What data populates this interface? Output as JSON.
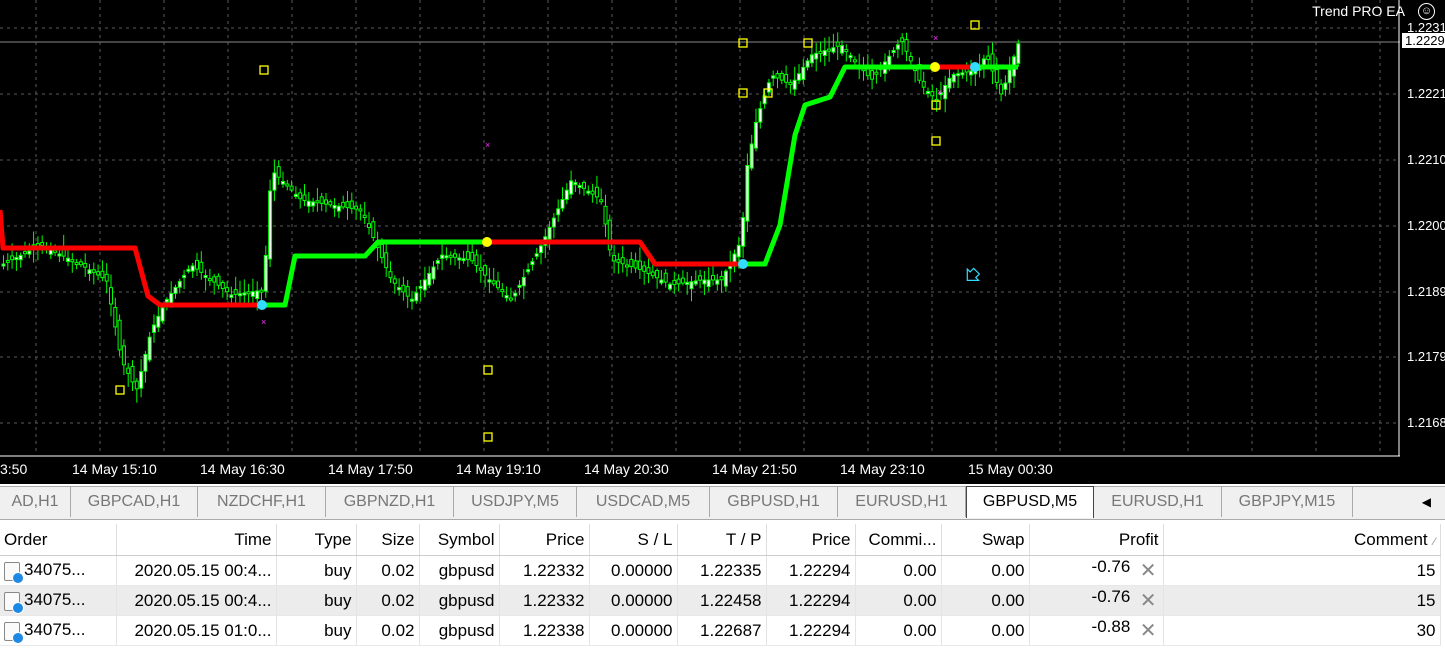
{
  "chart": {
    "ea_label": "Trend PRO EA",
    "ea_icon": "smiley-icon",
    "current_price": "1.2229",
    "price_labels": [
      "1.2231",
      "1.2221",
      "1.2210",
      "1.2200",
      "1.2189",
      "1.2179",
      "1.2168"
    ],
    "time_labels": [
      "3:50",
      "14 May 15:10",
      "14 May 16:30",
      "14 May 17:50",
      "14 May 19:10",
      "14 May 20:30",
      "14 May 21:50",
      "14 May 23:10",
      "15 May 00:30"
    ],
    "colors": {
      "background": "#000000",
      "candle": "#00ff00",
      "trend_up": "#00ff00",
      "trend_down": "#ff0000"
    }
  },
  "tabs": {
    "items": [
      "AD,H1",
      "GBPCAD,H1",
      "NZDCHF,H1",
      "GBPNZD,H1",
      "USDJPY,M5",
      "USDCAD,M5",
      "GBPUSD,H1",
      "EURUSD,H1",
      "GBPUSD,M5",
      "EURUSD,H1",
      "GBPJPY,M15"
    ],
    "active": "GBPUSD,M5",
    "scroll_icon": "scroll-left-icon"
  },
  "terminal": {
    "columns": [
      "Order",
      "Time",
      "Type",
      "Size",
      "Symbol",
      "Price",
      "S / L",
      "T / P",
      "Price",
      "Commi...",
      "Swap",
      "Profit",
      "Comment"
    ],
    "rows": [
      [
        "34075...",
        "2020.05.15 00:4...",
        "buy",
        "0.02",
        "gbpusd",
        "1.22332",
        "0.00000",
        "1.22335",
        "1.22294",
        "0.00",
        "0.00",
        "-0.76",
        "15"
      ],
      [
        "34075...",
        "2020.05.15 00:4...",
        "buy",
        "0.02",
        "gbpusd",
        "1.22332",
        "0.00000",
        "1.22458",
        "1.22294",
        "0.00",
        "0.00",
        "-0.76",
        "15"
      ],
      [
        "34075...",
        "2020.05.15 01:0...",
        "buy",
        "0.02",
        "gbpusd",
        "1.22338",
        "0.00000",
        "1.22687",
        "1.22294",
        "0.00",
        "0.00",
        "-0.88",
        "30"
      ]
    ]
  }
}
